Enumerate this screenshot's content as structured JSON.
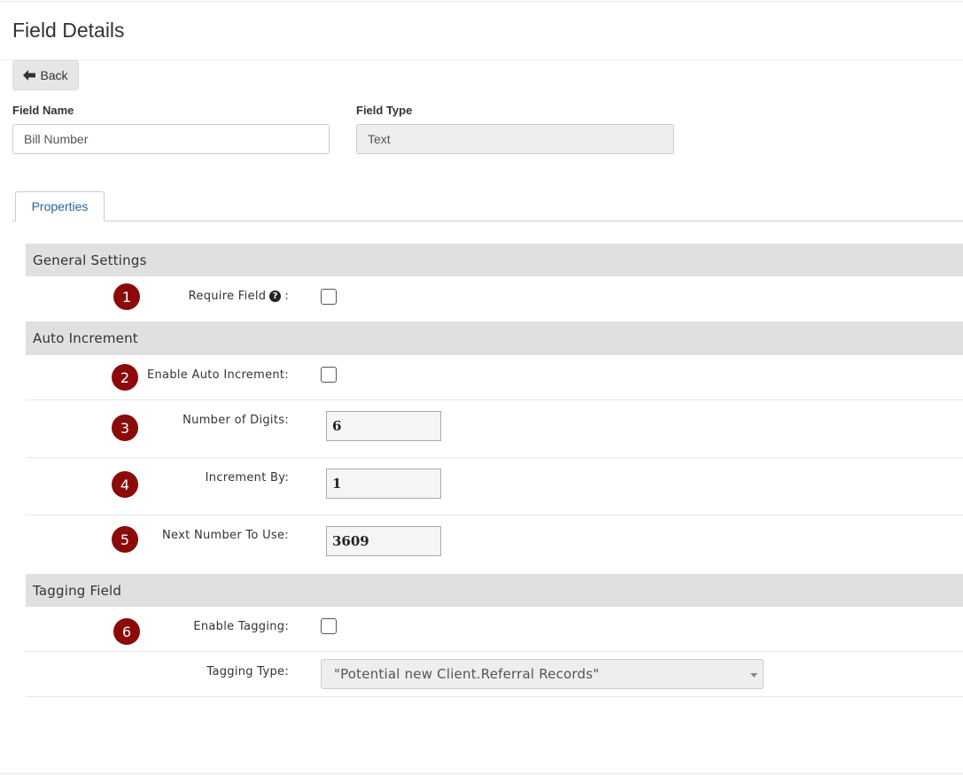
{
  "page": {
    "title": "Field Details",
    "back_label": "Back"
  },
  "field_name": {
    "label": "Field Name",
    "value": "Bill Number"
  },
  "field_type": {
    "label": "Field Type",
    "value": "Text"
  },
  "tabs": [
    {
      "label": "Properties",
      "active": true
    }
  ],
  "sections": {
    "general": {
      "title": "General Settings",
      "require_field": {
        "badge": "1",
        "label": "Require Field",
        "suffix": ":",
        "checked": false,
        "help_icon": "question-circle-icon"
      }
    },
    "auto_increment": {
      "title": "Auto Increment",
      "enable": {
        "badge": "2",
        "label": "Enable Auto Increment:",
        "checked": false
      },
      "digits": {
        "badge": "3",
        "label": "Number of Digits:",
        "value": "6"
      },
      "increment_by": {
        "badge": "4",
        "label": "Increment By:",
        "value": "1"
      },
      "next_number": {
        "badge": "5",
        "label": "Next Number To Use:",
        "value": "3609"
      }
    },
    "tagging": {
      "title": "Tagging Field",
      "enable": {
        "badge": "6",
        "label": "Enable Tagging:",
        "checked": false
      },
      "type": {
        "label": "Tagging Type:",
        "value": "\"Potential new Client.Referral Records\""
      }
    }
  },
  "colors": {
    "badge": "#8b0a0a",
    "section_bar": "#e0e0e0",
    "tab_text": "#2a6496"
  }
}
